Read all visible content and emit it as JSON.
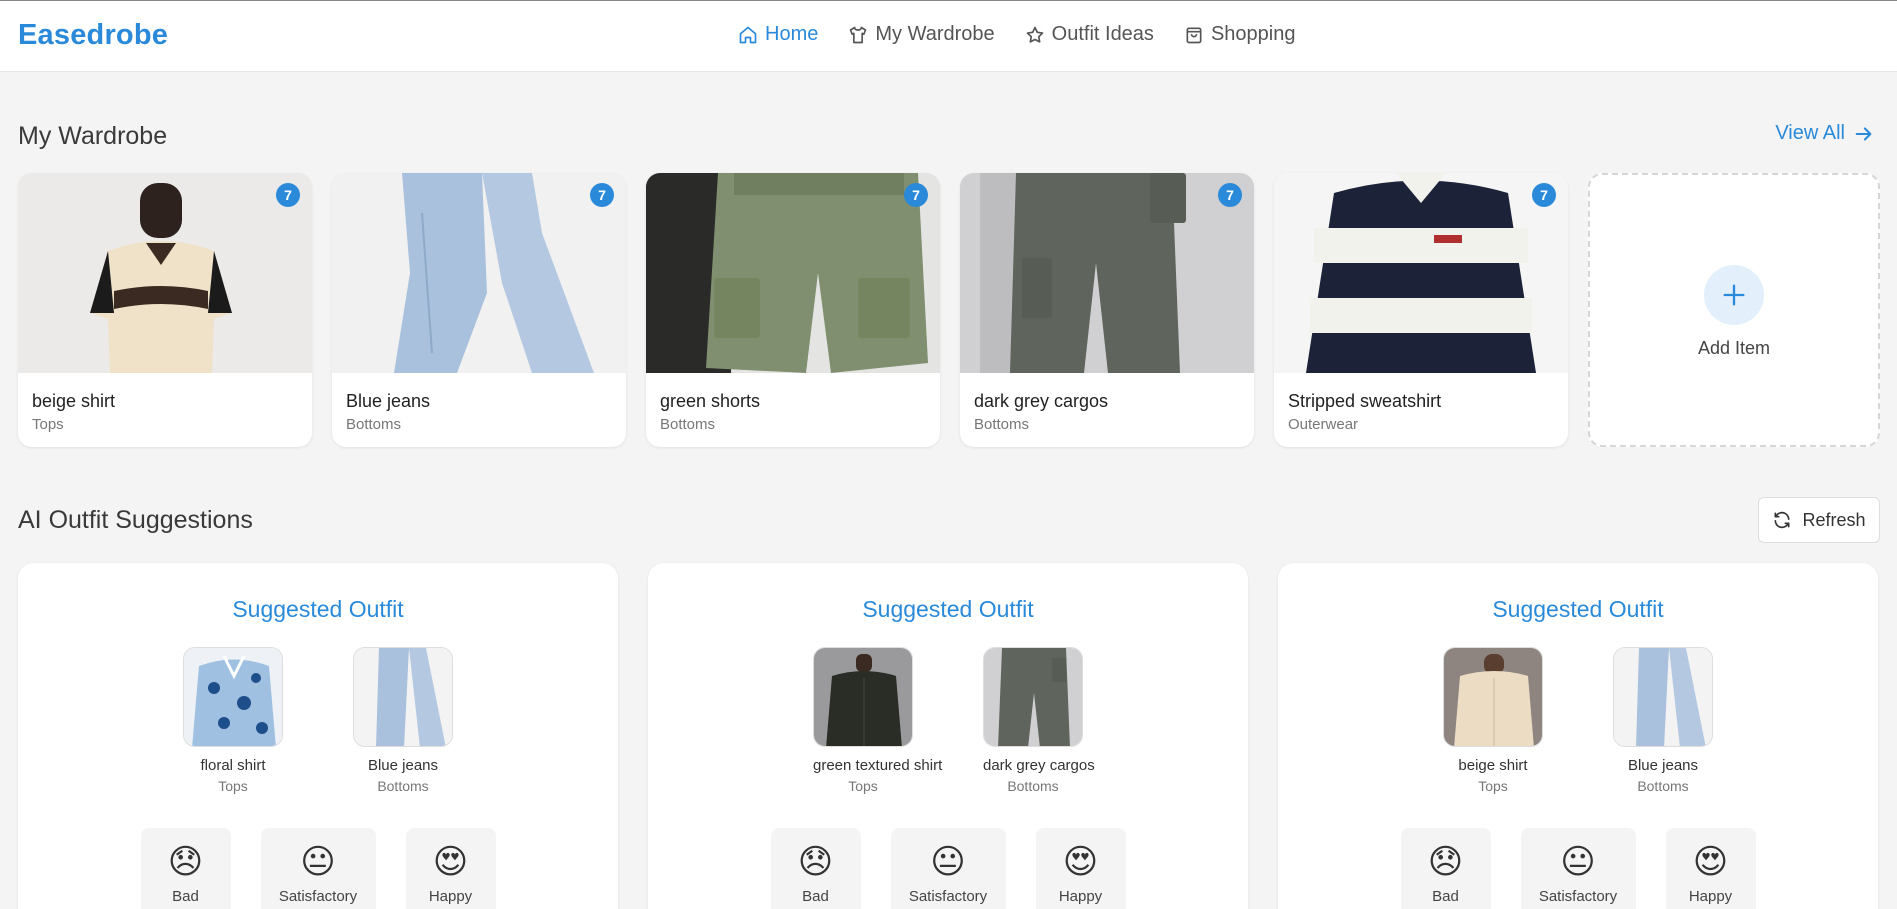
{
  "app": {
    "title": "Easedrobe"
  },
  "nav": [
    {
      "label": "Home",
      "icon": "home-icon",
      "active": true
    },
    {
      "label": "My Wardrobe",
      "icon": "shirt-icon"
    },
    {
      "label": "Outfit Ideas",
      "icon": "star-icon"
    },
    {
      "label": "Shopping",
      "icon": "bag-icon"
    }
  ],
  "wardrobe": {
    "title": "My Wardrobe",
    "view_all": "View All",
    "items": [
      {
        "name": "beige shirt",
        "category": "Tops",
        "badge": "7"
      },
      {
        "name": "Blue jeans",
        "category": "Bottoms",
        "badge": "7"
      },
      {
        "name": "green shorts",
        "category": "Bottoms",
        "badge": "7"
      },
      {
        "name": "dark grey cargos",
        "category": "Bottoms",
        "badge": "7"
      },
      {
        "name": "Stripped sweatshirt",
        "category": "Outerwear",
        "badge": "7"
      }
    ],
    "add_item": "Add Item"
  },
  "suggestions": {
    "title": "AI Outfit Suggestions",
    "refresh": "Refresh",
    "outfits": [
      {
        "title": "Suggested Outfit",
        "items": [
          {
            "name": "floral shirt",
            "category": "Tops"
          },
          {
            "name": "Blue jeans",
            "category": "Bottoms"
          }
        ]
      },
      {
        "title": "Suggested Outfit",
        "items": [
          {
            "name": "green textured shirt",
            "category": "Tops"
          },
          {
            "name": "dark grey cargos",
            "category": "Bottoms"
          }
        ]
      },
      {
        "title": "Suggested Outfit",
        "items": [
          {
            "name": "beige shirt",
            "category": "Tops"
          },
          {
            "name": "Blue jeans",
            "category": "Bottoms"
          }
        ]
      }
    ],
    "ratings": [
      {
        "label": "Bad",
        "emoji": "😞"
      },
      {
        "label": "Satisfactory",
        "emoji": "😐"
      },
      {
        "label": "Happy",
        "emoji": "😍"
      }
    ]
  },
  "colors": {
    "accent": "#2a8ad9",
    "background": "#f4f4f4"
  }
}
